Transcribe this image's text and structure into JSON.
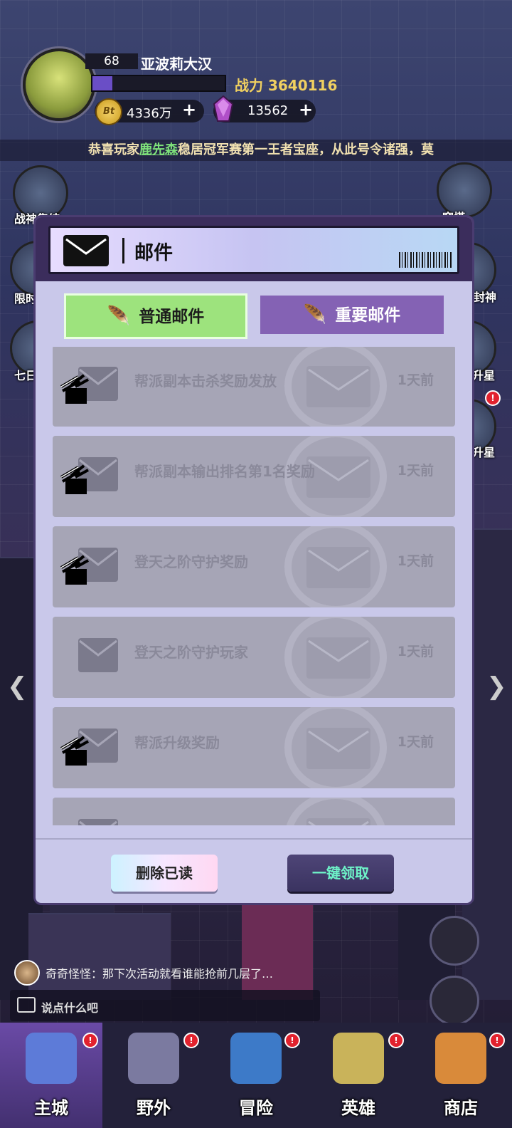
{
  "player": {
    "level": "68",
    "name": "亚波莉大汉",
    "xp_fraction": 0.15,
    "power_label": "战力",
    "power_value": "3640116",
    "coin_symbol": "Bt",
    "coins": "4336万",
    "gems": "13562",
    "plus": "+"
  },
  "marquee": {
    "prefix": "恭喜玩家",
    "player": "鹿先森",
    "suffix": "稳居冠军赛第一王者宝座，从此号令诸强，莫"
  },
  "side_buttons": {
    "left": [
      "战神集结",
      "限时",
      "七日"
    ],
    "right": [
      "穹塔",
      "封神",
      "升星",
      "升星"
    ]
  },
  "mail_dialog": {
    "title": "邮件",
    "tabs": {
      "normal": "普通邮件",
      "important": "重要邮件"
    },
    "mails": [
      {
        "subject": "帮派副本击杀奖励发放",
        "time": "1天前",
        "has_attachment": true
      },
      {
        "subject": "帮派副本输出排名第1名奖励",
        "time": "1天前",
        "has_attachment": true
      },
      {
        "subject": "登天之阶守护奖励",
        "time": "1天前",
        "has_attachment": true
      },
      {
        "subject": "登天之阶守护玩家",
        "time": "1天前",
        "has_attachment": false
      },
      {
        "subject": "帮派升级奖励",
        "time": "1天前",
        "has_attachment": true
      },
      {
        "subject": "",
        "time": "",
        "has_attachment": true
      }
    ],
    "delete_read": "删除已读",
    "collect_all": "一键领取"
  },
  "chat": {
    "last_message": "奇奇怪怪：那下次活动就看谁能抢前几层了…",
    "placeholder": "说点什么吧"
  },
  "nav": [
    "主城",
    "野外",
    "冒险",
    "英雄",
    "商店"
  ],
  "colors": {
    "tab_active": "#9de37d",
    "tab_inactive": "#8462b4",
    "power": "#f0d060",
    "collect_text": "#6ef3c8"
  }
}
